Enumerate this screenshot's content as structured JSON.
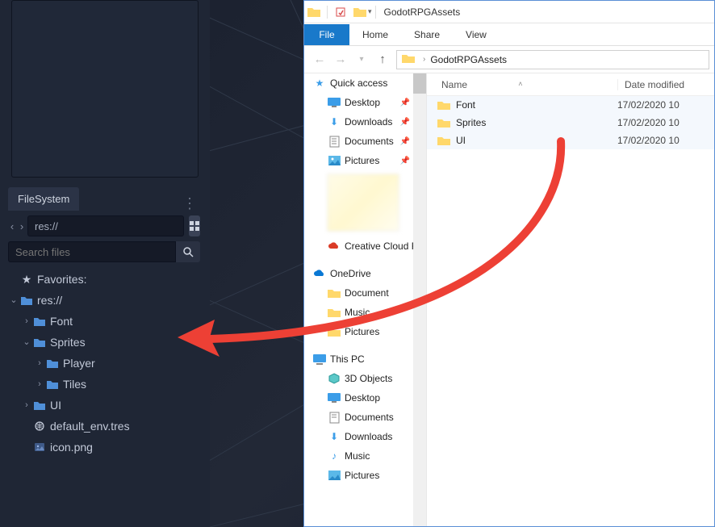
{
  "godot": {
    "filesystem_tab": "FileSystem",
    "path_value": "res://",
    "search_placeholder": "Search files",
    "favorites_label": "Favorites:",
    "tree": {
      "root": "res://",
      "font": "Font",
      "sprites": "Sprites",
      "player": "Player",
      "tiles": "Tiles",
      "ui": "UI",
      "default_env": "default_env.tres",
      "icon_png": "icon.png"
    }
  },
  "explorer": {
    "title": "GodotRPGAssets",
    "ribbon": {
      "file": "File",
      "home": "Home",
      "share": "Share",
      "view": "View"
    },
    "breadcrumb": "GodotRPGAssets",
    "columns": {
      "name": "Name",
      "date": "Date modified"
    },
    "sidebar": {
      "quick_access": "Quick access",
      "desktop": "Desktop",
      "downloads": "Downloads",
      "documents": "Documents",
      "pictures": "Pictures",
      "creative_cloud": "Creative Cloud Fil",
      "onedrive": "OneDrive",
      "od_documents": "Document",
      "od_music": "Music",
      "od_pictures": "Pictures",
      "this_pc": "This PC",
      "tp_3d": "3D Objects",
      "tp_desktop": "Desktop",
      "tp_documents": "Documents",
      "tp_downloads": "Downloads",
      "tp_music": "Music",
      "tp_pictures": "Pictures"
    },
    "files": [
      {
        "icon": "folder",
        "name": "Font",
        "date": "17/02/2020 10"
      },
      {
        "icon": "folder",
        "name": "Sprites",
        "date": "17/02/2020 10"
      },
      {
        "icon": "folder",
        "name": "UI",
        "date": "17/02/2020 10"
      }
    ]
  }
}
